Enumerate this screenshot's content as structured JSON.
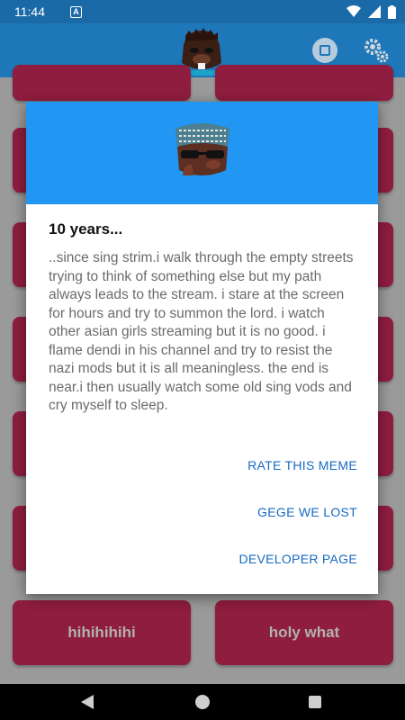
{
  "status_bar": {
    "time": "11:44",
    "notification_icon": "A"
  },
  "app_bar": {
    "logo_icon": "beaver-face-icon",
    "stop_icon": "stop-icon",
    "settings_icon": "gear-icon"
  },
  "grid": {
    "buttons": [
      {
        "label": ""
      },
      {
        "label": ""
      },
      {
        "label": ""
      },
      {
        "label": ""
      },
      {
        "label": ""
      },
      {
        "label": ""
      },
      {
        "label": ""
      },
      {
        "label": ""
      },
      {
        "label": ""
      },
      {
        "label": ""
      },
      {
        "label": ""
      },
      {
        "label": ""
      },
      {
        "label": "hihihihihi"
      },
      {
        "label": "holy what"
      }
    ]
  },
  "dialog": {
    "image_icon": "sunglasses-beaver-icon",
    "title": "10 years...",
    "message": "..since sing strim.i walk through the empty streets trying to think of something else but my path always leads to the stream. i stare at the screen for hours and try to summon the lord. i watch other asian girls streaming but it is no good. i flame dendi in his channel and try to resist the nazi mods but it is all meaningless. the end is near.i then usually watch some old sing vods and cry myself to sleep.",
    "actions": [
      "RATE THIS MEME",
      "GEGE WE LOST",
      "DEVELOPER PAGE"
    ]
  },
  "colors": {
    "status_bar": "#1b6aa8",
    "app_bar": "#1e77b8",
    "dialog_header": "#2196f3",
    "button": "#8f1d3f",
    "action_text": "#1669c2"
  }
}
